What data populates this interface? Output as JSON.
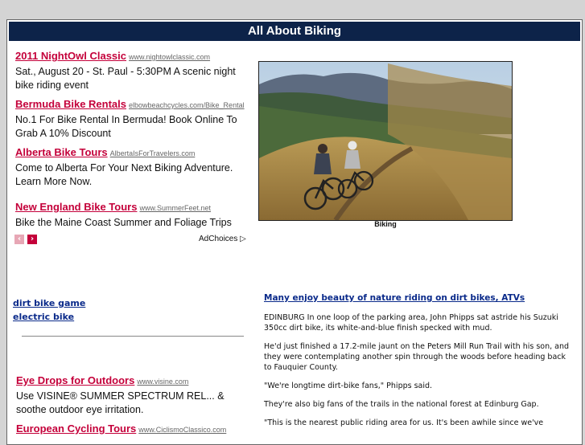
{
  "page_title": "All About Biking",
  "ads_top": [
    {
      "title": "2011 NightOwl Classic",
      "url": "www.nightowlclassic.com",
      "desc": "Sat., August 20 - St. Paul - 5:30PM A scenic night bike riding event"
    },
    {
      "title": "Bermuda Bike Rentals",
      "url": "elbowbeachcycles.com/Bike_Rental",
      "desc": "No.1 For Bike Rental In Bermuda! Book Online To Grab A 10% Discount"
    },
    {
      "title": "Alberta Bike Tours",
      "url": "AlbertaIsForTravelers.com",
      "desc": "Come to Alberta For Your Next Biking Adventure. Learn More Now."
    },
    {
      "title": "New England Bike Tours",
      "url": "www.SummerFeet.net",
      "desc": "Bike the Maine Coast Summer and Foliage Trips"
    }
  ],
  "adchoices_label": "AdChoices",
  "photo_caption": "Biking",
  "side_links": [
    "dirt bike game",
    "electric bike"
  ],
  "ads_bottom": [
    {
      "title": "Eye Drops for Outdoors",
      "url": "www.visine.com",
      "desc": "Use VISINE® SUMMER SPECTRUM REL... & soothe outdoor eye irritation."
    },
    {
      "title": "European Cycling Tours",
      "url": "www.CiclismoClassico.com",
      "desc": ""
    }
  ],
  "article": {
    "headline": "Many enjoy beauty of nature riding on dirt bikes, ATVs",
    "paragraphs": [
      "EDINBURG In one loop of the parking area, John Phipps sat astride his Suzuki 350cc dirt bike, its white-and-blue finish specked with mud.",
      "He'd just finished a 17.2-mile jaunt on the Peters Mill Run Trail with his son, and they were contemplating another spin through the woods before heading back to Fauquier County.",
      "\"We're longtime dirt-bike fans,\" Phipps said.",
      "They're also big fans of the trails in the national forest at Edinburg Gap.",
      "\"This is the nearest public riding area for us. It's been awhile since we've"
    ]
  },
  "colors": {
    "header_bg": "#0d2349",
    "ad_title": "#c4003a",
    "link": "#0a2a8a"
  }
}
